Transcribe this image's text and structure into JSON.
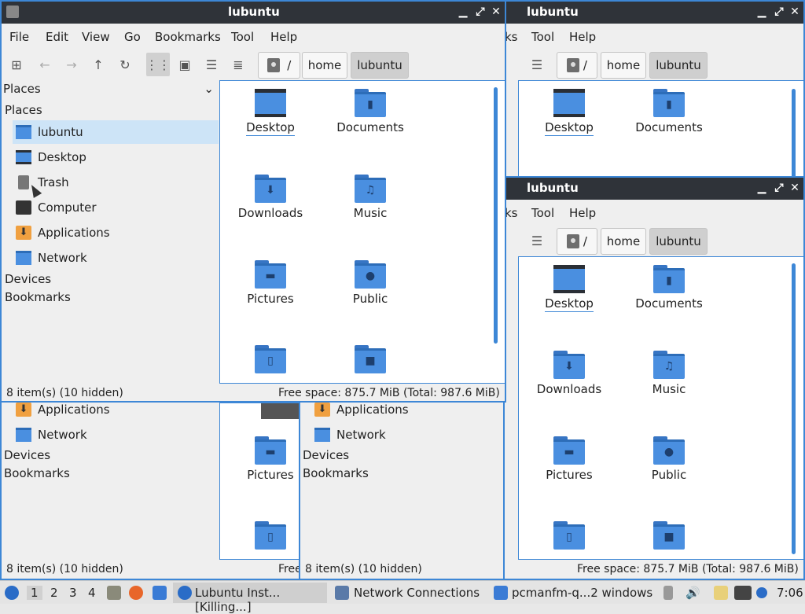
{
  "window_title": "lubuntu",
  "menu": [
    "File",
    "Edit",
    "View",
    "Go",
    "Bookmarks",
    "Tool",
    "Help"
  ],
  "toolbar": {
    "new_tab_icon": "new-tab-icon",
    "back_icon": "arrow-left-icon",
    "forward_icon": "arrow-right-icon",
    "up_icon": "arrow-up-icon",
    "reload_icon": "reload-icon",
    "icon_view": "grid-icon",
    "thumb_view": "image-icon",
    "compact_view": "list-icon",
    "detail_view": "detail-list-icon"
  },
  "path": {
    "root": "/",
    "home": "home",
    "user": "lubuntu"
  },
  "sidebar": {
    "dropdown_label": "Places",
    "places_header": "Places",
    "items": [
      {
        "label": "lubuntu",
        "icon": "home-folder-icon"
      },
      {
        "label": "Desktop",
        "icon": "desktop-icon"
      },
      {
        "label": "Trash",
        "icon": "trash-icon"
      },
      {
        "label": "Computer",
        "icon": "computer-icon"
      },
      {
        "label": "Applications",
        "icon": "applications-icon"
      },
      {
        "label": "Network",
        "icon": "network-icon"
      }
    ],
    "devices_header": "Devices",
    "bookmarks_header": "Bookmarks"
  },
  "files": [
    {
      "label": "Desktop",
      "icon": "desktop-folder-icon"
    },
    {
      "label": "Documents",
      "icon": "documents-folder-icon"
    },
    {
      "label": "Downloads",
      "icon": "downloads-folder-icon"
    },
    {
      "label": "Music",
      "icon": "music-folder-icon"
    },
    {
      "label": "Pictures",
      "icon": "pictures-folder-icon"
    },
    {
      "label": "Public",
      "icon": "public-folder-icon"
    },
    {
      "label": "",
      "icon": "templates-folder-icon"
    },
    {
      "label": "",
      "icon": "videos-folder-icon"
    }
  ],
  "status": {
    "items": "8 item(s) (10 hidden)",
    "free_space": "Free space: 875.7 MiB (Total: 987.6 MiB)",
    "free_partial": "Free"
  },
  "taskbar": {
    "workspaces": [
      "1",
      "2",
      "3",
      "4"
    ],
    "tasks": [
      "Lubuntu Inst...[Killing...]",
      "Network Connections",
      "pcmanfm-q...2 windows"
    ],
    "clock": "7:06"
  },
  "colors": {
    "accent": "#3d87d6",
    "titlebar": "#2f3339",
    "folder": "#4a8fe0"
  }
}
